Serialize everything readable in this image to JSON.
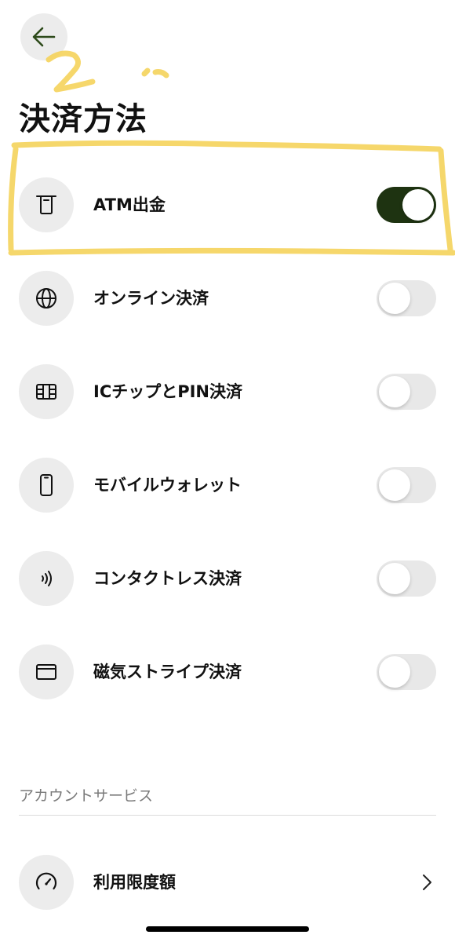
{
  "header": {
    "title": "決済方法",
    "back_icon": "arrow-left-icon"
  },
  "payment_methods": [
    {
      "label": "ATM出金",
      "icon": "atm-icon",
      "enabled": true
    },
    {
      "label": "オンライン決済",
      "icon": "globe-icon",
      "enabled": false
    },
    {
      "label": "ICチップとPIN決済",
      "icon": "chip-card-icon",
      "enabled": false
    },
    {
      "label": "モバイルウォレット",
      "icon": "smartphone-icon",
      "enabled": false
    },
    {
      "label": "コンタクトレス決済",
      "icon": "contactless-icon",
      "enabled": false
    },
    {
      "label": "磁気ストライプ決済",
      "icon": "card-icon",
      "enabled": false
    }
  ],
  "account_services": {
    "section_label": "アカウントサービス",
    "items": [
      {
        "label": "利用限度額",
        "icon": "gauge-icon"
      }
    ]
  },
  "annotation": {
    "handwritten_text": "2."
  },
  "colors": {
    "toggle_on": "#1e3311",
    "toggle_off": "#e8e8e8",
    "icon_bg": "#ececec",
    "highlight": "#f5d35b"
  }
}
